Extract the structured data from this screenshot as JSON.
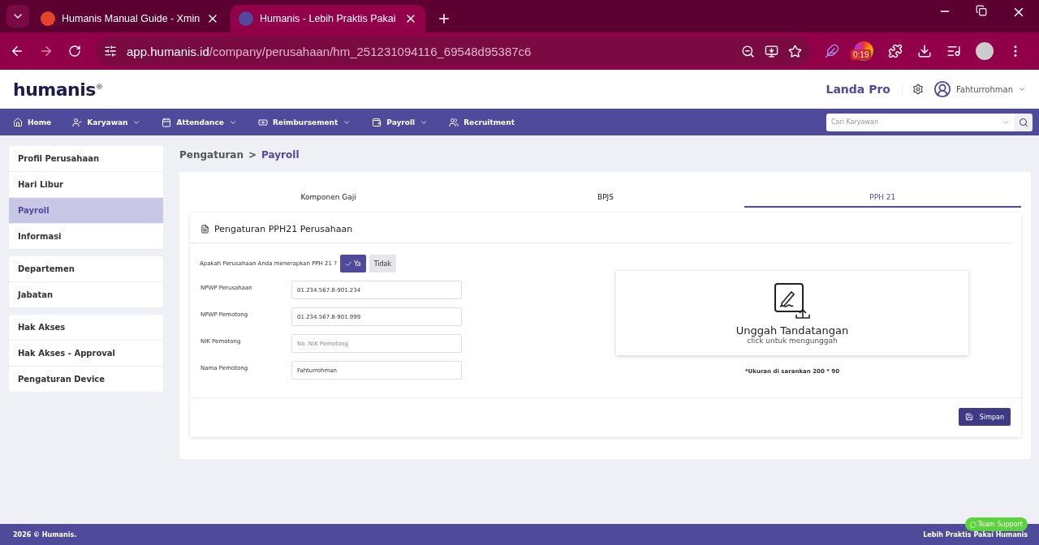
{
  "browser": {
    "tabs": [
      {
        "title": "Humanis Manual Guide - Xmin",
        "selected": false
      },
      {
        "title": "Humanis - Lebih Praktis Pakai",
        "selected": true
      }
    ],
    "address": {
      "host": "app.humanis.id",
      "path": "/company/perusahaan/hm_251231094116_69548d95387c6"
    },
    "extension_badge": "0:19"
  },
  "header": {
    "logo": "humanis$^{®}$",
    "company": "Landa Pro",
    "user": "Fahturrohman"
  },
  "nav": {
    "items": [
      {
        "label": "Home",
        "dropdown": false
      },
      {
        "label": "Karyawan",
        "dropdown": true
      },
      {
        "label": "Attendance",
        "dropdown": true
      },
      {
        "label": "Reimbursement",
        "dropdown": true
      },
      {
        "label": "Payroll",
        "dropdown": true
      },
      {
        "label": "Recruitment",
        "dropdown": false
      }
    ],
    "search": {
      "placeholder": "Cari Karyawan"
    }
  },
  "sidebar": {
    "groups": [
      [
        {
          "label": "Profil Perusahaan",
          "selected": false
        },
        {
          "label": "Hari Libur",
          "selected": false
        },
        {
          "label": "Payroll",
          "selected": true
        },
        {
          "label": "Informasi",
          "selected": false
        }
      ],
      [
        {
          "label": "Departemen",
          "selected": false
        },
        {
          "label": "Jabatan",
          "selected": false
        }
      ],
      [
        {
          "label": "Hak Akses",
          "selected": false
        },
        {
          "label": "Hak Akses - Approval",
          "selected": false
        },
        {
          "label": "Pengaturan Device",
          "selected": false
        }
      ]
    ]
  },
  "breadcrumb": {
    "parent": "Pengaturan",
    "separator": ">",
    "current": "Payroll"
  },
  "tabs": [
    {
      "label": "Komponen Gaji",
      "selected": false
    },
    {
      "label": "BPJS",
      "selected": false
    },
    {
      "label": "PPH 21",
      "selected": true
    }
  ],
  "card": {
    "title": "Pengaturan PPH21 Perusahaan",
    "question": "Apakah Perusahaan Anda menerapkan PPH 21 ?",
    "options": [
      {
        "label": "Ya",
        "selected": true
      },
      {
        "label": "Tidak",
        "selected": false
      }
    ],
    "fields": [
      {
        "label": "NPWP Perusahaan",
        "value": "01.234.567.8-901.234"
      },
      {
        "label": "NPWP Pemotong",
        "value": "01.234.567.8-901.999"
      },
      {
        "label": "NIK Pemotong",
        "placeholder": "No. NIK Pemotong"
      },
      {
        "label": "Nama Pemotong",
        "value": "Fahturrohman"
      }
    ],
    "upload": {
      "title": "Unggah Tandatangan",
      "subtitle": "click untuk mengunggah",
      "note": "*Ukuran di sarankan 200 * 90"
    },
    "save": "Simpan"
  },
  "footer": {
    "left": "2026 © Humanis.",
    "right": "Lebih Praktis Pakai Humanis",
    "support": "Team Support"
  }
}
